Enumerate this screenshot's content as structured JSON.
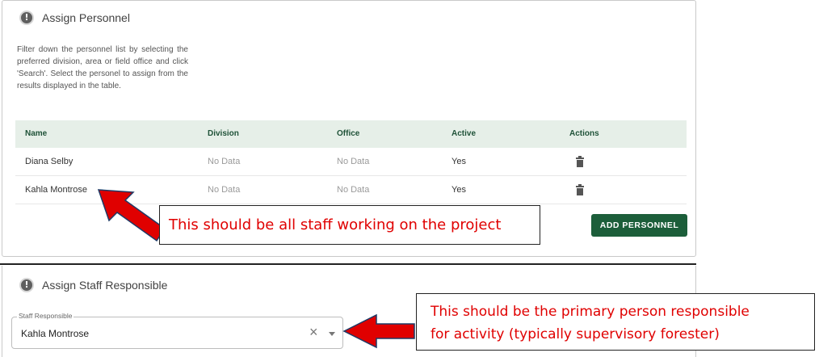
{
  "assign_personnel": {
    "title": "Assign Personnel",
    "description": "Filter down the personnel list by selecting the preferred division, area or field office and click 'Search'. Select the personel to assign from the results displayed in the table.",
    "table": {
      "columns": [
        "Name",
        "Division",
        "Office",
        "Active",
        "Actions"
      ],
      "rows": [
        {
          "name": "Diana Selby",
          "division": "No Data",
          "office": "No Data",
          "active": "Yes"
        },
        {
          "name": "Kahla Montrose",
          "division": "No Data",
          "office": "No Data",
          "active": "Yes"
        }
      ]
    },
    "add_button": "ADD PERSONNEL"
  },
  "assign_staff": {
    "title": "Assign Staff Responsible",
    "field_label": "Staff Responsible",
    "field_value": "Kahla Montrose"
  },
  "annotations": {
    "callout1": "This should be all staff working on the project",
    "callout2_line1": "This should be the primary person responsible",
    "callout2_line2": "for activity (typically supervisory forester)"
  },
  "icons": {
    "section": "exclamation-circle-icon",
    "delete": "trash-icon",
    "clear": "close-icon",
    "dropdown": "caret-down-icon"
  },
  "colors": {
    "header_bg": "#e6efe8",
    "header_text": "#1f5238",
    "button_bg": "#1c5e3a",
    "annotation_red": "#e00000"
  }
}
